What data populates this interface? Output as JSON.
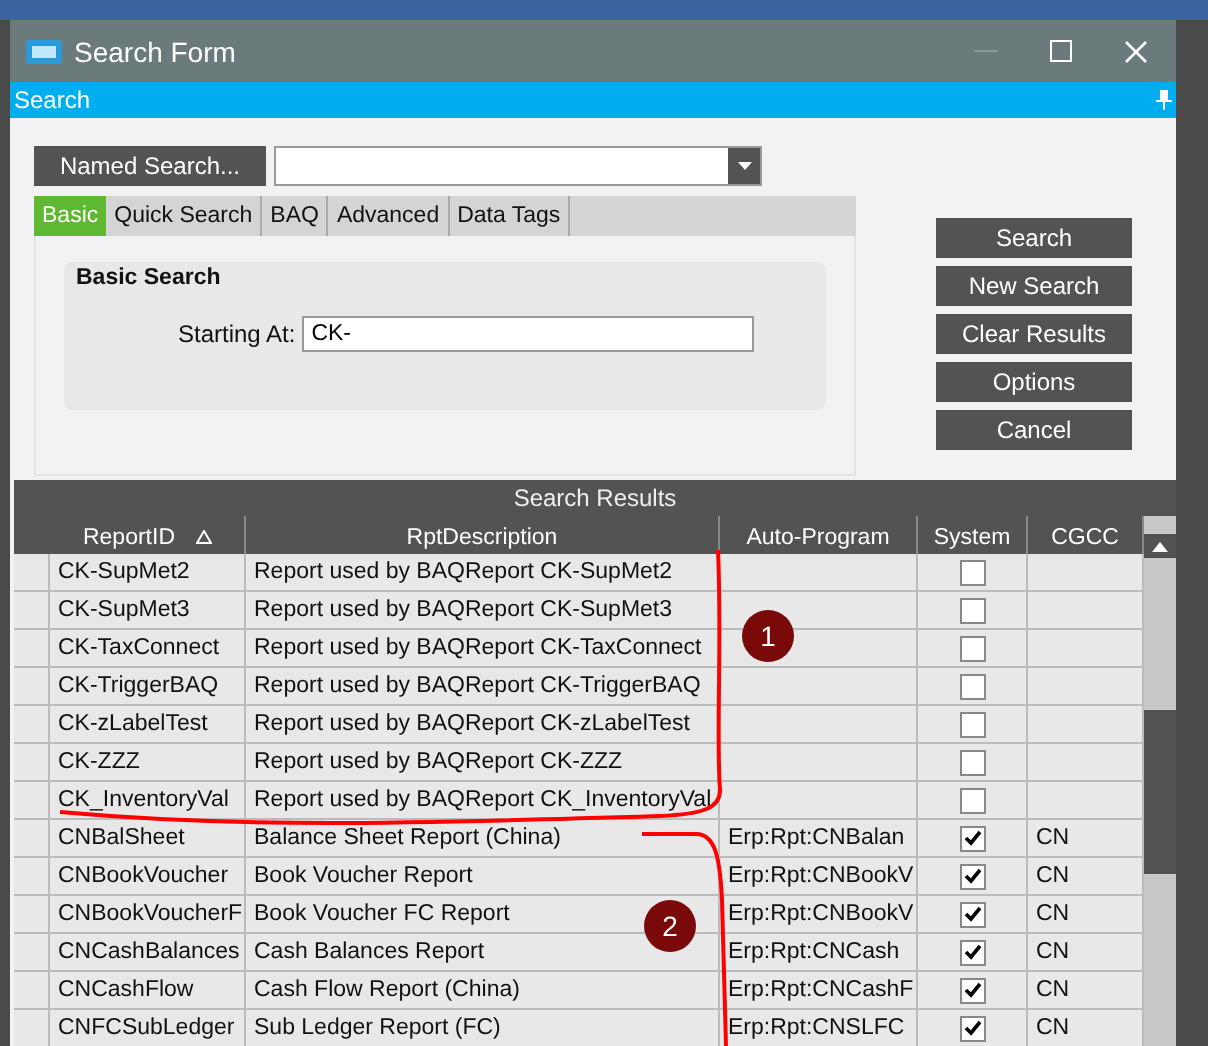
{
  "window": {
    "title": "Search Form"
  },
  "panel": {
    "title": "Search"
  },
  "named_search": {
    "label": "Named Search..."
  },
  "tabs": [
    {
      "label": "Basic",
      "selected": true
    },
    {
      "label": "Quick Search",
      "selected": false
    },
    {
      "label": "BAQ",
      "selected": false
    },
    {
      "label": "Advanced",
      "selected": false
    },
    {
      "label": "Data Tags",
      "selected": false
    }
  ],
  "basic_search": {
    "title": "Basic Search",
    "field": {
      "label": "Starting At:",
      "value": "CK-"
    }
  },
  "buttons": [
    "Search",
    "New Search",
    "Clear Results",
    "Options",
    "Cancel"
  ],
  "results": {
    "title": "Search Results",
    "columns": [
      {
        "label": "ReportID",
        "sorted": true
      },
      {
        "label": "RptDescription",
        "sorted": false
      },
      {
        "label": "Auto-Program",
        "sorted": false
      },
      {
        "label": "System",
        "sorted": false
      },
      {
        "label": "CGCC",
        "sorted": false
      }
    ],
    "rows": [
      {
        "report_id": "CK-SupMet2",
        "description": "Report used by BAQReport CK-SupMet2",
        "auto_program": "",
        "system": false,
        "cgcc": ""
      },
      {
        "report_id": "CK-SupMet3",
        "description": "Report used by BAQReport CK-SupMet3",
        "auto_program": "",
        "system": false,
        "cgcc": ""
      },
      {
        "report_id": "CK-TaxConnect",
        "description": "Report used by BAQReport CK-TaxConnect",
        "auto_program": "",
        "system": false,
        "cgcc": ""
      },
      {
        "report_id": "CK-TriggerBAQ",
        "description": "Report used by BAQReport CK-TriggerBAQ",
        "auto_program": "",
        "system": false,
        "cgcc": ""
      },
      {
        "report_id": "CK-zLabelTest",
        "description": "Report used by BAQReport CK-zLabelTest",
        "auto_program": "",
        "system": false,
        "cgcc": ""
      },
      {
        "report_id": "CK-ZZZ",
        "description": "Report used by BAQReport CK-ZZZ",
        "auto_program": "",
        "system": false,
        "cgcc": ""
      },
      {
        "report_id": "CK_InventoryVal",
        "description": "Report used by BAQReport CK_InventoryVal",
        "auto_program": "",
        "system": false,
        "cgcc": ""
      },
      {
        "report_id": "CNBalSheet",
        "description": "Balance Sheet Report (China)",
        "auto_program": "Erp:Rpt:CNBalan",
        "system": true,
        "cgcc": "CN"
      },
      {
        "report_id": "CNBookVoucher",
        "description": "Book Voucher Report",
        "auto_program": "Erp:Rpt:CNBookV",
        "system": true,
        "cgcc": "CN"
      },
      {
        "report_id": "CNBookVoucherF",
        "description": "Book Voucher FC Report",
        "auto_program": "Erp:Rpt:CNBookV",
        "system": true,
        "cgcc": "CN"
      },
      {
        "report_id": "CNCashBalances",
        "description": "Cash Balances Report",
        "auto_program": "Erp:Rpt:CNCash",
        "system": true,
        "cgcc": "CN"
      },
      {
        "report_id": "CNCashFlow",
        "description": "Cash Flow Report (China)",
        "auto_program": "Erp:Rpt:CNCashF",
        "system": true,
        "cgcc": "CN"
      },
      {
        "report_id": "CNFCSubLedger",
        "description": "Sub Ledger Report (FC)",
        "auto_program": "Erp:Rpt:CNSLFC",
        "system": true,
        "cgcc": "CN"
      }
    ]
  },
  "annotations": [
    {
      "label": "1"
    },
    {
      "label": "2"
    }
  ]
}
